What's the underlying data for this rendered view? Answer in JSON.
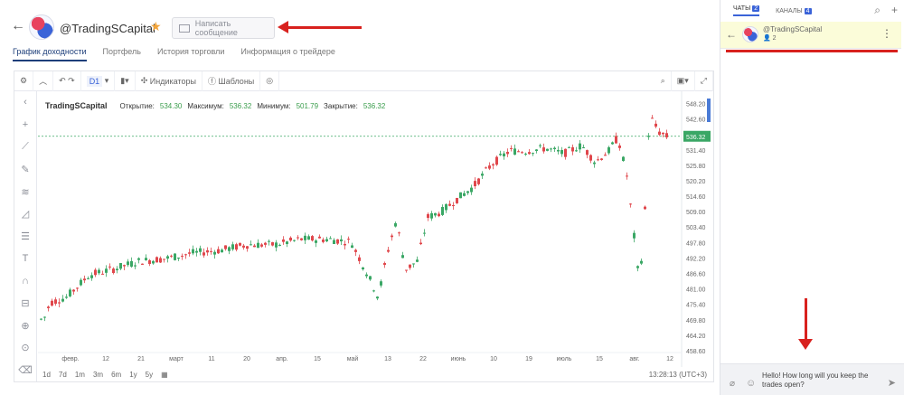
{
  "header": {
    "trader_name": "@TradingSCapital",
    "message_button": "Написать сообщение"
  },
  "tabs": [
    {
      "label": "График доходности",
      "active": true
    },
    {
      "label": "Портфель"
    },
    {
      "label": "История торговли"
    },
    {
      "label": "Информация о трейдере"
    }
  ],
  "toolbar": {
    "interval": "D1",
    "indicators": "Индикаторы",
    "templates": "Шаблоны"
  },
  "legend": {
    "name": "TradingSCapital",
    "open_label": "Открытие:",
    "open": "534.30",
    "high_label": "Максимум:",
    "high": "536.32",
    "low_label": "Минимум:",
    "low": "501.79",
    "close_label": "Закрытие:",
    "close": "536.32"
  },
  "chart_data": {
    "type": "candlestick",
    "last_price": "536.32",
    "y_ticks": [
      "548.20",
      "542.60",
      "536.32",
      "531.40",
      "525.80",
      "520.20",
      "514.60",
      "509.00",
      "503.40",
      "497.80",
      "492.20",
      "486.60",
      "481.00",
      "475.40",
      "469.80",
      "464.20",
      "458.60"
    ],
    "x_ticks": [
      "февр.",
      "12",
      "21",
      "март",
      "11",
      "20",
      "апр.",
      "15",
      "май",
      "13",
      "22",
      "июнь",
      "10",
      "19",
      "июль",
      "15",
      "авг.",
      "12"
    ],
    "ylim": [
      458.6,
      550
    ]
  },
  "bottom_bar": {
    "ranges": [
      "1d",
      "7d",
      "1m",
      "3m",
      "6m",
      "1y",
      "5y"
    ],
    "time": "13:28:13 (UTC+3)"
  },
  "right": {
    "chats_label": "ЧАТЫ",
    "chats_count": "2",
    "channels_label": "КАНАЛЫ",
    "channels_count": "4",
    "chat_name": "@TradingSCapital",
    "chat_members": "2",
    "compose_text": "Hello! How long will you keep the trades open?"
  }
}
